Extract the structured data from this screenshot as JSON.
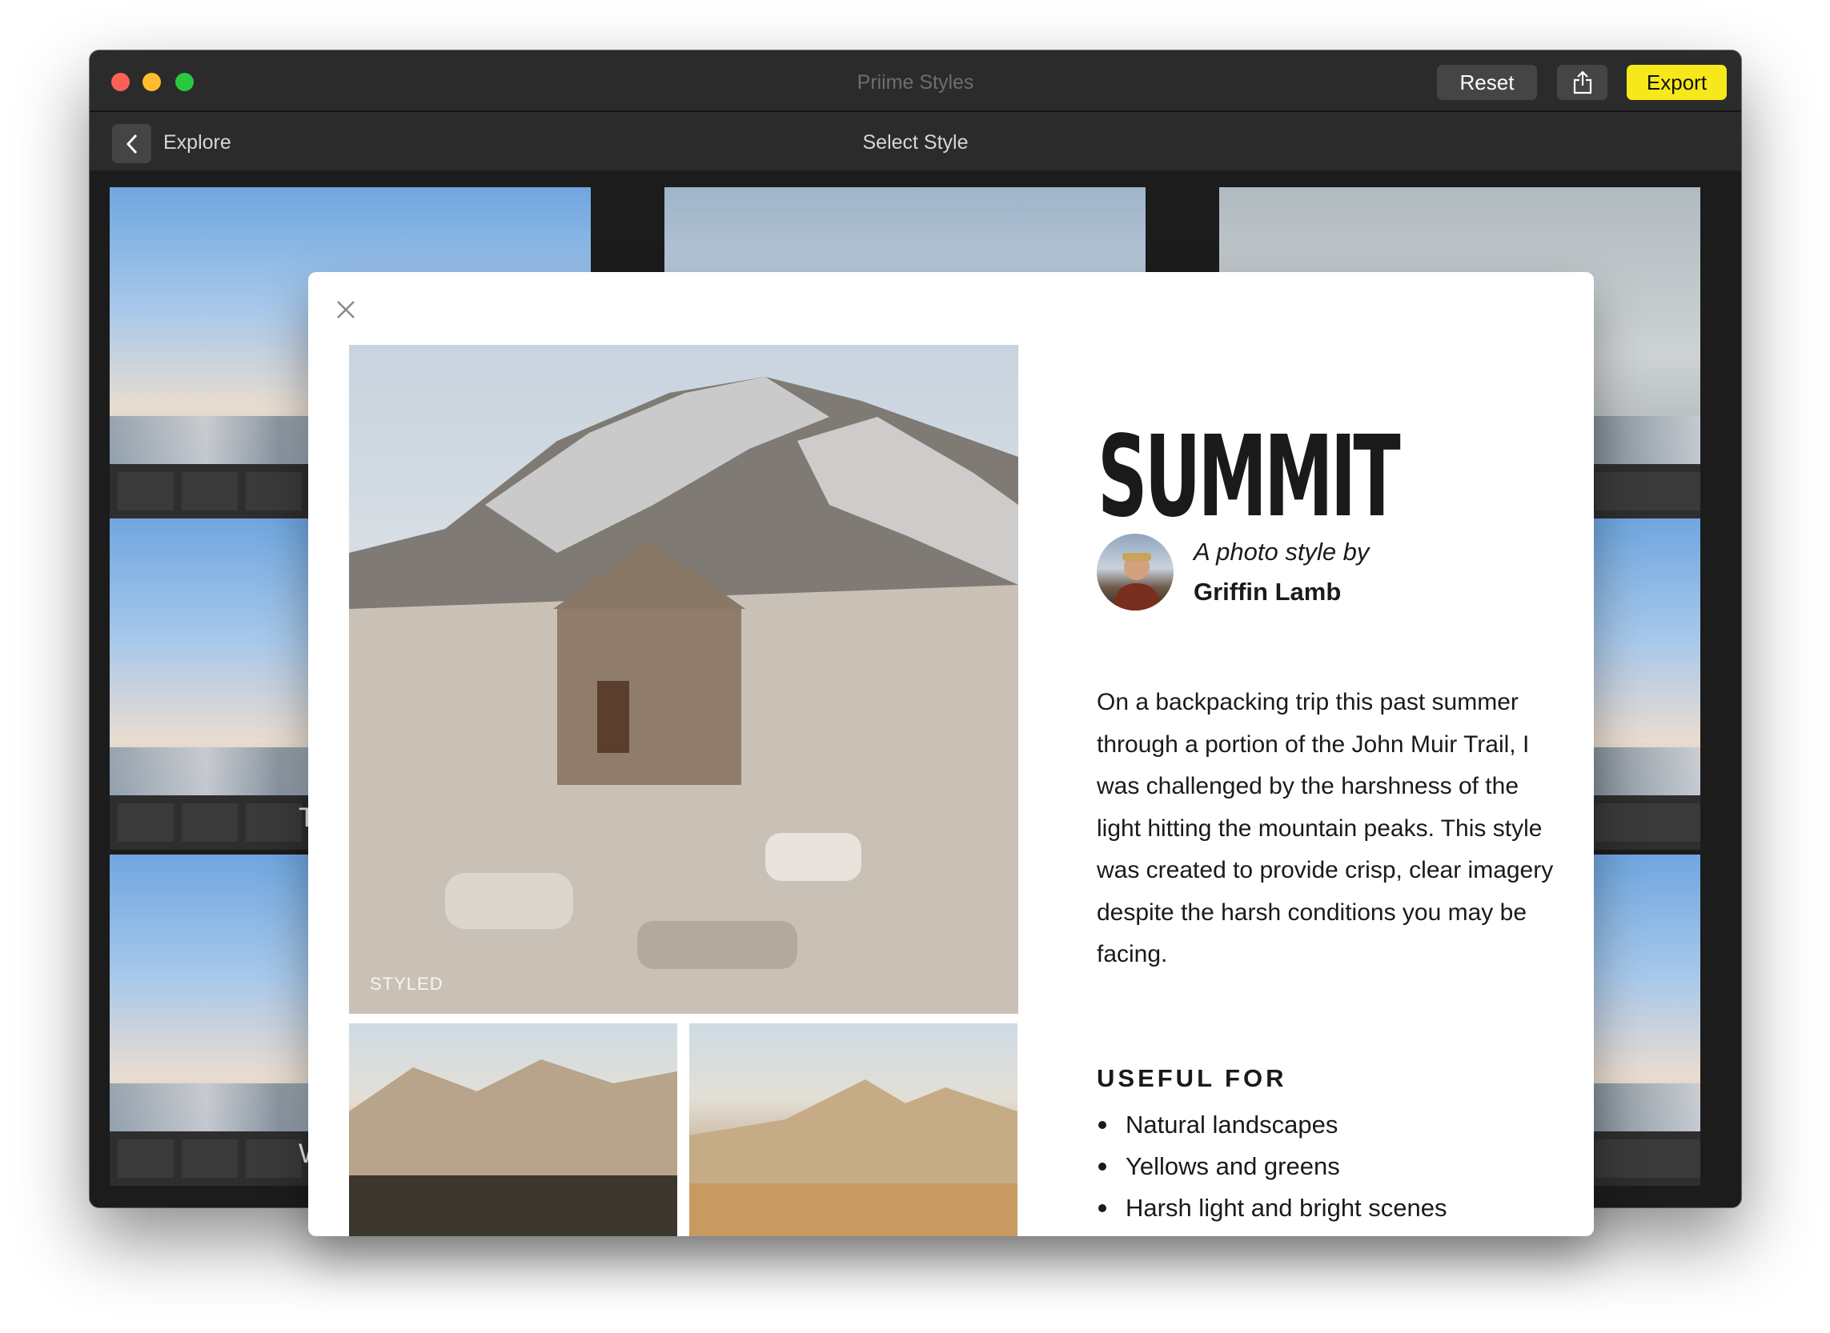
{
  "window": {
    "title": "Priime Styles",
    "buttons": {
      "reset": "Reset",
      "export": "Export",
      "share_icon": "share-icon"
    }
  },
  "nav": {
    "back_label": "Explore",
    "title": "Select Style"
  },
  "grid": {
    "tiles": [
      {
        "label": ""
      },
      {
        "label": ""
      },
      {
        "label": ""
      },
      {
        "label": "T"
      },
      {
        "label": ""
      },
      {
        "label": ""
      },
      {
        "label": "W"
      },
      {
        "label": ""
      },
      {
        "label": ""
      }
    ]
  },
  "modal": {
    "style_name": "SUMMIT",
    "byline": "A photo style by",
    "author": "Griffin Lamb",
    "photo_tag": "STYLED",
    "description": "On a backpacking trip this past summer through a portion of the John Muir Trail, I was challenged by the harshness of the light hitting the mountain peaks. This style was created to provide crisp, clear imagery despite the harsh conditions you may be facing.",
    "useful_for_heading": "USEFUL FOR",
    "useful_for": [
      "Natural landscapes",
      "Yellows and greens",
      "Harsh light and bright scenes"
    ]
  },
  "colors": {
    "export_button": "#f7e81b",
    "window_bg": "#1e1e1e",
    "titlebar": "#2b2b2b"
  }
}
